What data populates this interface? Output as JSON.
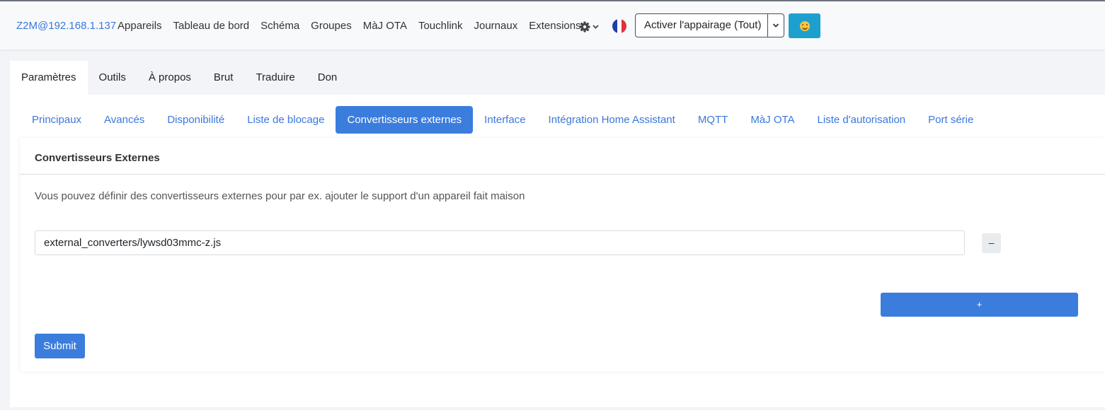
{
  "navbar": {
    "brand": "Z2M@192.168.1.137",
    "links": [
      "Appareils",
      "Tableau de bord",
      "Schéma",
      "Groupes",
      "MàJ OTA",
      "Touchlink",
      "Journaux",
      "Extensions"
    ],
    "permit_join_label": "Activer l'appairage (Tout)"
  },
  "main_tabs": [
    "Paramètres",
    "Outils",
    "À propos",
    "Brut",
    "Traduire",
    "Don"
  ],
  "sub_tabs": [
    "Principaux",
    "Avancés",
    "Disponibilité",
    "Liste de blocage",
    "Convertisseurs externes",
    "Interface",
    "Intégration Home Assistant",
    "MQTT",
    "MàJ OTA",
    "Liste d'autorisation",
    "Port série"
  ],
  "card": {
    "title": "Convertisseurs Externes",
    "description": "Vous pouvez définir des convertisseurs externes pour par ex. ajouter le support d'un appareil fait maison",
    "converter_value": "external_converters/lywsd03mmc-z.js",
    "remove_label": "–",
    "add_label": "+",
    "submit_label": "Submit"
  },
  "colors": {
    "accent": "#3b7ddd",
    "link": "#3b78dc",
    "emoji_button": "#1ea0cf"
  }
}
